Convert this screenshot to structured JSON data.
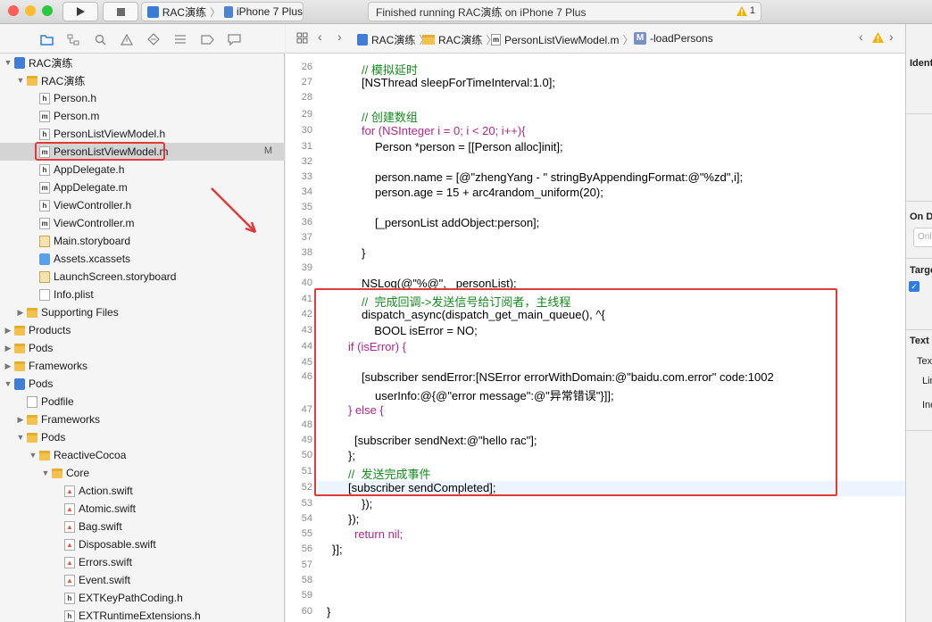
{
  "toolbar": {
    "scheme_project": "RAC演练",
    "scheme_device": "iPhone 7 Plus",
    "activity_status": "Finished running RAC演练 on iPhone 7 Plus",
    "warning_count": "1"
  },
  "navigator": {
    "items": [
      {
        "label": "RAC演练",
        "type": "project",
        "expanded": true
      },
      {
        "label": "RAC演练",
        "type": "folder",
        "expanded": true
      },
      {
        "label": "Person.h",
        "type": "h"
      },
      {
        "label": "Person.m",
        "type": "m"
      },
      {
        "label": "PersonListViewModel.h",
        "type": "h"
      },
      {
        "label": "PersonListViewModel.m",
        "type": "m",
        "selected": true,
        "badge": "M"
      },
      {
        "label": "AppDelegate.h",
        "type": "h"
      },
      {
        "label": "AppDelegate.m",
        "type": "m"
      },
      {
        "label": "ViewController.h",
        "type": "h"
      },
      {
        "label": "ViewController.m",
        "type": "m"
      },
      {
        "label": "Main.storyboard",
        "type": "storyboard"
      },
      {
        "label": "Assets.xcassets",
        "type": "assets"
      },
      {
        "label": "LaunchScreen.storyboard",
        "type": "storyboard"
      },
      {
        "label": "Info.plist",
        "type": "plist"
      },
      {
        "label": "Supporting Files",
        "type": "folder",
        "expanded": false
      },
      {
        "label": "Products",
        "type": "folder",
        "expanded": false
      },
      {
        "label": "Pods",
        "type": "folder",
        "expanded": false
      },
      {
        "label": "Frameworks",
        "type": "folder",
        "expanded": false
      },
      {
        "label": "Pods",
        "type": "project",
        "expanded": true
      },
      {
        "label": "Podfile",
        "type": "file"
      },
      {
        "label": "Frameworks",
        "type": "folder",
        "expanded": false
      },
      {
        "label": "Pods",
        "type": "folder",
        "expanded": true
      },
      {
        "label": "ReactiveCocoa",
        "type": "folder",
        "expanded": true
      },
      {
        "label": "Core",
        "type": "folder",
        "expanded": true
      },
      {
        "label": "Action.swift",
        "type": "swift"
      },
      {
        "label": "Atomic.swift",
        "type": "swift"
      },
      {
        "label": "Bag.swift",
        "type": "swift"
      },
      {
        "label": "Disposable.swift",
        "type": "swift"
      },
      {
        "label": "Errors.swift",
        "type": "swift"
      },
      {
        "label": "Event.swift",
        "type": "swift"
      },
      {
        "label": "EXTKeyPathCoding.h",
        "type": "h"
      },
      {
        "label": "EXTRuntimeExtensions.h",
        "type": "h"
      }
    ]
  },
  "jumpbar": {
    "crumbs": [
      "RAC演练",
      "RAC演练",
      "PersonListViewModel.m",
      "-loadPersons"
    ],
    "method_badge": "M"
  },
  "editor": {
    "current_line": "52",
    "lines": [
      {
        "n": "26",
        "indent": 1,
        "code": "// 模拟延时"
      },
      {
        "n": "27",
        "indent": 1,
        "code": "[NSThread sleepForTimeInterval:1.0];"
      },
      {
        "n": "28",
        "indent": 0,
        "code": ""
      },
      {
        "n": "29",
        "indent": 1,
        "code": "// 创建数组"
      },
      {
        "n": "30",
        "indent": 1,
        "code": "for (NSInteger i = 0; i < 20; i++){"
      },
      {
        "n": "31",
        "indent": 2,
        "code": "Person *person = [[Person alloc]init];"
      },
      {
        "n": "32",
        "indent": 0,
        "code": ""
      },
      {
        "n": "33",
        "indent": 2,
        "code": "person.name = [@\"zhengYang - \" stringByAppendingFormat:@\"%zd\",i];"
      },
      {
        "n": "34",
        "indent": 2,
        "code": "person.age = 15 + arc4random_uniform(20);"
      },
      {
        "n": "35",
        "indent": 0,
        "code": ""
      },
      {
        "n": "36",
        "indent": 2,
        "code": "[_personList addObject:person];"
      },
      {
        "n": "37",
        "indent": 0,
        "code": ""
      },
      {
        "n": "38",
        "indent": 1,
        "code": "}"
      },
      {
        "n": "39",
        "indent": 0,
        "code": ""
      },
      {
        "n": "40",
        "indent": 1,
        "code": "NSLog(@\"%@\", _personList);"
      },
      {
        "n": "41",
        "indent": 1,
        "code": "//  完成回调->发送信号给订阅者，主线程"
      },
      {
        "n": "42",
        "indent": 1,
        "code": "dispatch_async(dispatch_get_main_queue(), ^{"
      },
      {
        "n": "43",
        "indent": 1,
        "code": "  BOOL isError = NO;"
      },
      {
        "n": "44",
        "indent": 0,
        "code": "if (isError) {"
      },
      {
        "n": "45",
        "indent": 0,
        "code": ""
      },
      {
        "n": "46",
        "indent": 1,
        "code": "[subscriber sendError:[NSError errorWithDomain:@\"baidu.com.error\" code:1002"
      },
      {
        "n": "",
        "indent": 2,
        "code": "userInfo:@{@\"error message\":@\"异常错误\"}]];"
      },
      {
        "n": "47",
        "indent": 0,
        "code": "} else {"
      },
      {
        "n": "48",
        "indent": 0,
        "code": ""
      },
      {
        "n": "49",
        "indent": 1,
        "code": "[subscriber sendNext:@\"hello rac\"];"
      },
      {
        "n": "50",
        "indent": 0,
        "code": "};"
      },
      {
        "n": "51",
        "indent": 0,
        "code": "//  发送完成事件"
      },
      {
        "n": "52",
        "indent": 0,
        "code": "[subscriber sendCompleted];"
      },
      {
        "n": "53",
        "indent": 1,
        "code": "});"
      },
      {
        "n": "54",
        "indent": 0,
        "code": "});"
      },
      {
        "n": "55",
        "indent": 1,
        "code": "return nil;"
      },
      {
        "n": "56",
        "indent": 0,
        "code": "}];"
      },
      {
        "n": "57",
        "indent": 0,
        "code": ""
      },
      {
        "n": "58",
        "indent": 0,
        "code": ""
      },
      {
        "n": "59",
        "indent": 0,
        "code": ""
      },
      {
        "n": "60",
        "indent": 0,
        "code": "}"
      }
    ]
  },
  "inspector": {
    "sections": [
      "Ident",
      "On D",
      "Targe",
      "Text"
    ],
    "fields": [
      "Onl",
      "Text",
      "Lin",
      "Ind"
    ]
  },
  "colors": {
    "highlight_border": "#e23a3a",
    "keyword": "#b0268d",
    "string": "#d12f1b",
    "comment": "#148a1e",
    "number": "#2f2ecf"
  }
}
